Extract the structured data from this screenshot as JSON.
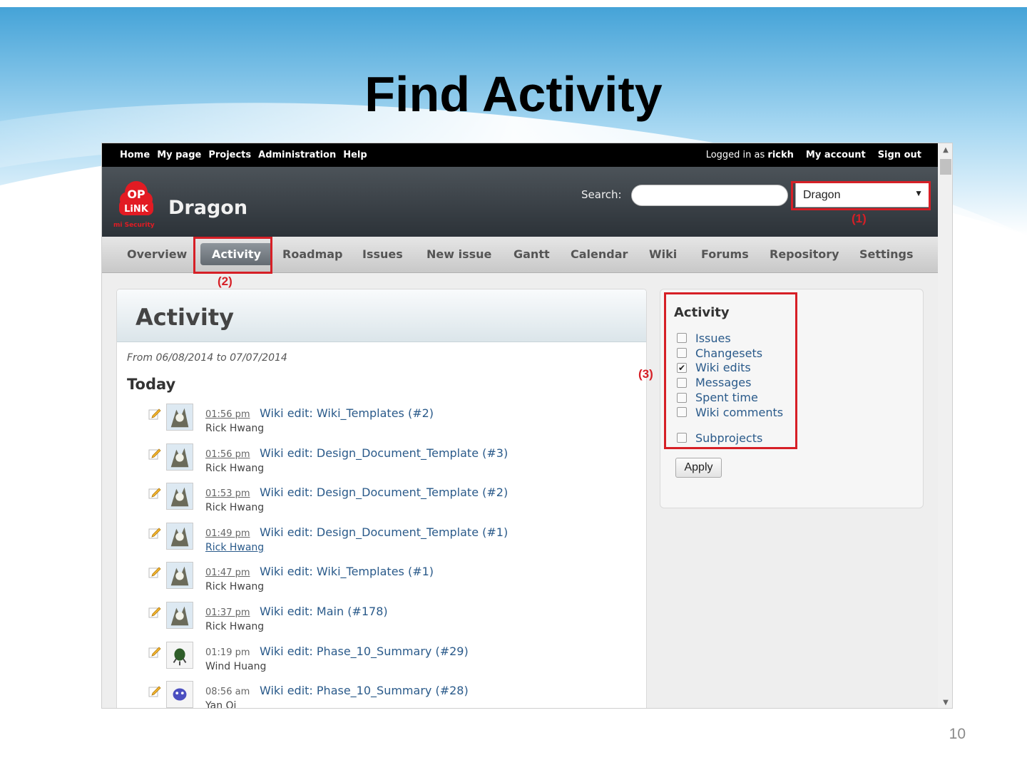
{
  "slide": {
    "title": "Find Activity",
    "page_number": "10"
  },
  "topbar": {
    "left_items": [
      "Home",
      "My page",
      "Projects",
      "Administration",
      "Help"
    ],
    "logged_in_prefix": "Logged in as",
    "username": "rickh",
    "my_account": "My account",
    "sign_out": "Sign out"
  },
  "header": {
    "project_name": "Dragon",
    "search_label": "Search:",
    "search_value": "",
    "project_select_value": "Dragon",
    "logo_top": "OP",
    "logo_bottom": "LiNK",
    "logo_tagline": "mi Security"
  },
  "tabs": {
    "items": [
      "Overview",
      "Activity",
      "Roadmap",
      "Issues",
      "New issue",
      "Gantt",
      "Calendar",
      "Wiki",
      "Forums",
      "Repository",
      "Settings"
    ],
    "active": "Activity"
  },
  "annotations": {
    "label_1": "(1)",
    "label_2": "(2)",
    "label_3": "(3)"
  },
  "main": {
    "heading": "Activity",
    "date_range": "From 06/08/2014 to 07/07/2014",
    "day_heading": "Today",
    "events": [
      {
        "time": "01:56 pm",
        "title": "Wiki edit: Wiki_Templates (#2)",
        "author": "Rick Hwang"
      },
      {
        "time": "01:56 pm",
        "title": "Wiki edit: Design_Document_Template (#3)",
        "author": "Rick Hwang"
      },
      {
        "time": "01:53 pm",
        "title": "Wiki edit: Design_Document_Template (#2)",
        "author": "Rick Hwang"
      },
      {
        "time": "01:49 pm",
        "title": "Wiki edit: Design_Document_Template (#1)",
        "author": "Rick Hwang"
      },
      {
        "time": "01:47 pm",
        "title": "Wiki edit: Wiki_Templates (#1)",
        "author": "Rick Hwang"
      },
      {
        "time": "01:37 pm",
        "title": "Wiki edit: Main (#178)",
        "author": "Rick Hwang"
      },
      {
        "time": "01:19 pm",
        "title": "Wiki edit: Phase_10_Summary (#29)",
        "author": "Wind Huang"
      },
      {
        "time": "08:56 am",
        "title": "Wiki edit: Phase_10_Summary (#28)",
        "author": "Yan Qi"
      }
    ]
  },
  "sidebar": {
    "heading": "Activity",
    "filters": [
      {
        "label": "Issues",
        "checked": false
      },
      {
        "label": "Changesets",
        "checked": false
      },
      {
        "label": "Wiki edits",
        "checked": true
      },
      {
        "label": "Messages",
        "checked": false
      },
      {
        "label": "Spent time",
        "checked": false
      },
      {
        "label": "Wiki comments",
        "checked": false
      }
    ],
    "subprojects": {
      "label": "Subprojects",
      "checked": false
    },
    "apply_label": "Apply"
  },
  "colors": {
    "annotation_red": "#d61f26",
    "link_blue": "#2a5a8a",
    "header_dark": "#2c3238"
  }
}
